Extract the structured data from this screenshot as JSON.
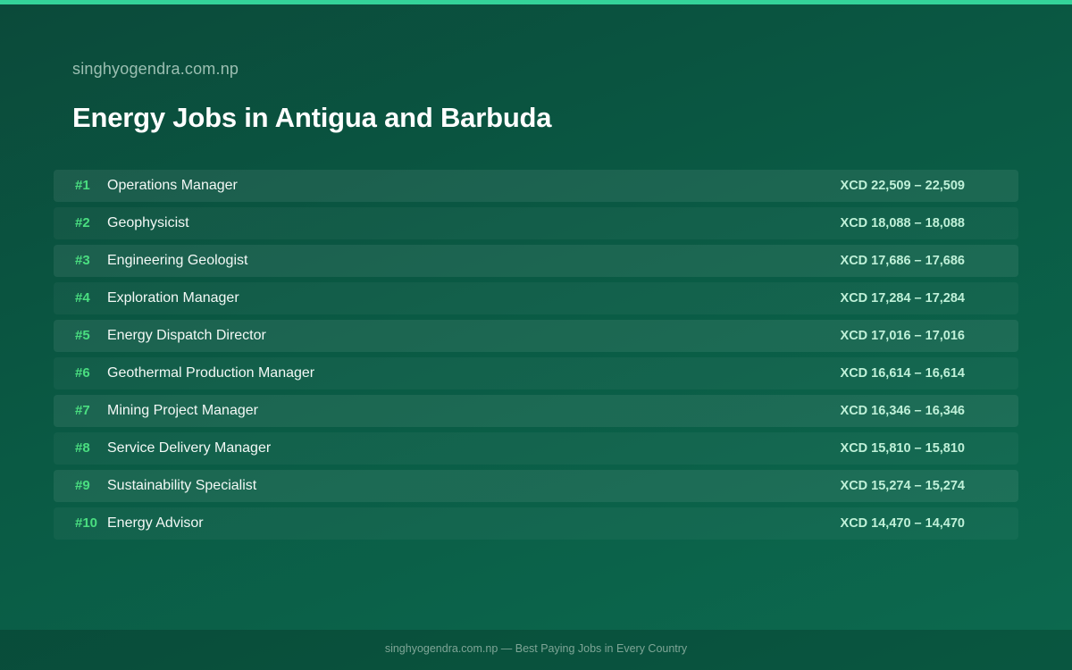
{
  "colors": {
    "accent": "#34d399",
    "rank": "#4ade80",
    "background": "#0a5a44",
    "salary": "#bff0d8"
  },
  "header": {
    "site_name": "singhyogendra.com.np",
    "title": "Energy Jobs in Antigua and Barbuda"
  },
  "jobs": [
    {
      "rank": "#1",
      "title": "Operations Manager",
      "salary": "XCD 22,509 – 22,509"
    },
    {
      "rank": "#2",
      "title": "Geophysicist",
      "salary": "XCD 18,088 – 18,088"
    },
    {
      "rank": "#3",
      "title": "Engineering Geologist",
      "salary": "XCD 17,686 – 17,686"
    },
    {
      "rank": "#4",
      "title": "Exploration Manager",
      "salary": "XCD 17,284 – 17,284"
    },
    {
      "rank": "#5",
      "title": "Energy Dispatch Director",
      "salary": "XCD 17,016 – 17,016"
    },
    {
      "rank": "#6",
      "title": "Geothermal Production Manager",
      "salary": "XCD 16,614 – 16,614"
    },
    {
      "rank": "#7",
      "title": "Mining Project Manager",
      "salary": "XCD 16,346 – 16,346"
    },
    {
      "rank": "#8",
      "title": "Service Delivery Manager",
      "salary": "XCD 15,810 – 15,810"
    },
    {
      "rank": "#9",
      "title": "Sustainability Specialist",
      "salary": "XCD 15,274 – 15,274"
    },
    {
      "rank": "#10",
      "title": "Energy Advisor",
      "salary": "XCD 14,470 – 14,470"
    }
  ],
  "footer": {
    "text": "singhyogendra.com.np — Best Paying Jobs in Every Country"
  }
}
